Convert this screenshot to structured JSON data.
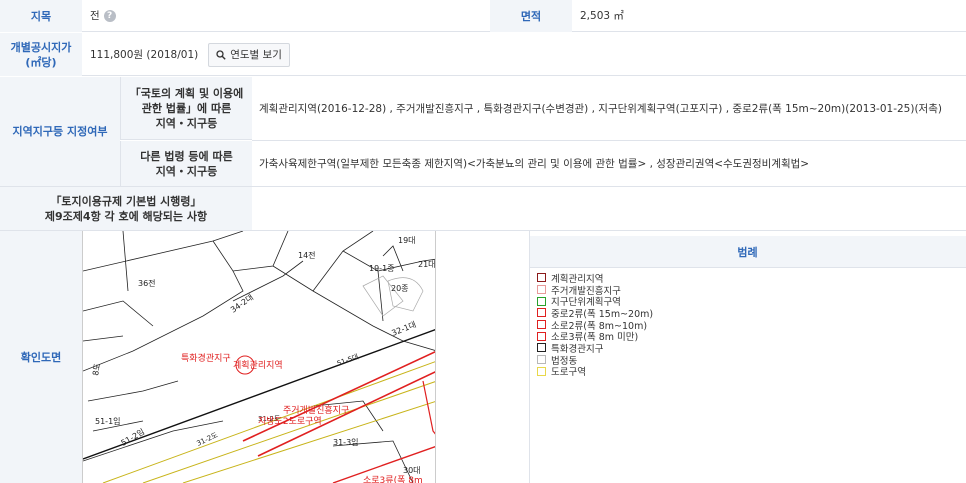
{
  "rows": {
    "jimok": {
      "label": "지목",
      "value": "전",
      "help": "?"
    },
    "area": {
      "label": "면적",
      "value": "2,503 ㎡"
    },
    "price": {
      "label_line1": "개별공시지가",
      "label_line2": "(㎡당)",
      "value": "111,800원 (2018/01)",
      "button": "연도별 보기"
    },
    "zone": {
      "label": "지역지구등 지정여부",
      "sub1_line1": "「국토의 계획 및 이용에",
      "sub1_line2": "관한 법률」에 따른",
      "sub1_line3": "지역・지구등",
      "sub1_value": "계획관리지역(2016-12-28) , 주거개발진흥지구 , 특화경관지구(수변경관) , 지구단위계획구역(고포지구) , 중로2류(폭 15m~20m)(2013-01-25)(저촉)",
      "sub2_line1": "다른 법령 등에 따른",
      "sub2_line2": "지역・지구등",
      "sub2_value": "가축사육제한구역(일부제한 모든축종 제한지역)<가축분뇨의 관리 및 이용에 관한 법률> , 성장관리권역<수도권정비계획법>"
    },
    "article": {
      "label_line1": "「토지이용규제 기본법 시행령」",
      "label_line2": "제9조제4항 각 호에 해당되는 사항",
      "value": ""
    },
    "map": {
      "label": "확인도면"
    }
  },
  "legend": {
    "title": "범례",
    "items": [
      {
        "label": "계획관리지역",
        "color": "#8b1a1a"
      },
      {
        "label": "주거개발진흥지구",
        "color": "#e89a9a"
      },
      {
        "label": "지구단위계획구역",
        "color": "#2aa02a"
      },
      {
        "label": "중로2류(폭 15m~20m)",
        "color": "#e02020"
      },
      {
        "label": "소로2류(폭 8m~10m)",
        "color": "#e02020"
      },
      {
        "label": "소로3류(폭 8m 미만)",
        "color": "#e02020"
      },
      {
        "label": "특화경관지구",
        "color": "#222222"
      },
      {
        "label": "법정동",
        "color": "#b8b8b8"
      },
      {
        "label": "도로구역",
        "color": "#e8d84a"
      }
    ]
  },
  "map_labels": {
    "parcels": [
      "14전",
      "19대",
      "19-1종",
      "21대",
      "36전",
      "20종",
      "34-2대",
      "32-1대",
      "8도",
      "51-1임",
      "51-2임",
      "31-1임",
      "31-2도",
      "31-3임",
      "30대",
      "51-5대",
      "34-2도",
      "32-2",
      "31-1전"
    ],
    "zones": [
      "특화경관지구",
      "계획관리지역",
      "주거개발진흥지구",
      "지방도2도로구역",
      "소로3류(폭 8m"
    ]
  }
}
